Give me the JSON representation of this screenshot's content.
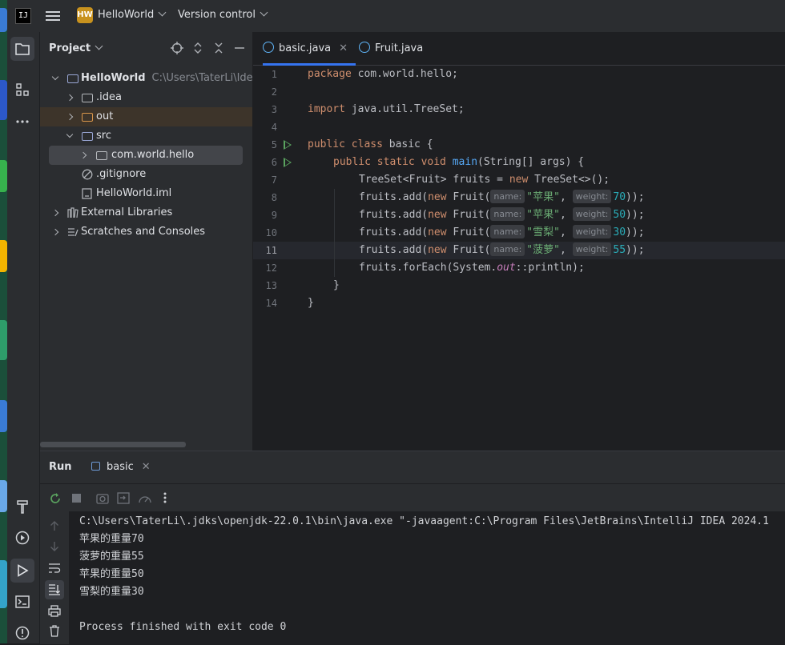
{
  "titlebar": {
    "logo": "IJ",
    "project_badge": "HW",
    "project_name": "HelloWorld",
    "vcs_label": "Version control",
    "menu_icon": "hamburger-icon"
  },
  "project_panel": {
    "title": "Project",
    "tree": [
      {
        "label": "HelloWorld",
        "path": "C:\\Users\\TaterLi\\IdeaPr",
        "expanded": true,
        "icon": "module-folder-icon"
      },
      {
        "label": ".idea",
        "icon": "folder-icon"
      },
      {
        "label": "out",
        "icon": "folder-icon"
      },
      {
        "label": "src",
        "expanded": true,
        "icon": "source-folder-icon"
      },
      {
        "label": "com.world.hello",
        "icon": "package-icon"
      },
      {
        "label": ".gitignore",
        "icon": "gitignore-icon"
      },
      {
        "label": "HelloWorld.iml",
        "icon": "file-icon"
      },
      {
        "label": "External Libraries",
        "icon": "library-icon"
      },
      {
        "label": "Scratches and Consoles",
        "icon": "scratches-icon"
      }
    ]
  },
  "editor": {
    "tabs": [
      {
        "label": "basic.java",
        "active": true
      },
      {
        "label": "Fruit.java",
        "active": false
      }
    ],
    "line_numbers": [
      "1",
      "2",
      "3",
      "4",
      "5",
      "6",
      "7",
      "8",
      "9",
      "10",
      "11",
      "12",
      "13",
      "14"
    ],
    "current_line": "11",
    "code": {
      "l1_kw": "package",
      "l1_rest": " com.world.hello;",
      "l3_kw": "import",
      "l3_rest": " java.util.TreeSet;",
      "l5_kw": "public class",
      "l5_rest": " basic {",
      "l6_kw": "public static void",
      "l6_fn": "main",
      "l6_rest": "(String[] args) {",
      "l7_a": "TreeSet<Fruit> fruits = ",
      "l7_kw": "new",
      "l7_b": " TreeSet<>();",
      "add_prefix": "fruits.add(",
      "new_kw": "new",
      "fruit_ctor": " Fruit(",
      "name_hint": "name:",
      "weight_hint": "weight:",
      "rows": [
        {
          "name": "\"苹果\"",
          "weight": "70"
        },
        {
          "name": "\"苹果\"",
          "weight": "50"
        },
        {
          "name": "\"雪梨\"",
          "weight": "30"
        },
        {
          "name": "\"菠萝\"",
          "weight": "55"
        }
      ],
      "comma": ", ",
      "close": "));",
      "l12_a": "fruits.forEach(System.",
      "l12_out": "out",
      "l12_b": "::println);",
      "l13": "}",
      "l14": "}"
    }
  },
  "run_panel": {
    "title": "Run",
    "tab_label": "basic",
    "console": [
      "C:\\Users\\TaterLi\\.jdks\\openjdk-22.0.1\\bin\\java.exe \"-javaagent:C:\\Program Files\\JetBrains\\IntelliJ IDEA 2024.1",
      "苹果的重量70",
      "菠萝的重量55",
      "苹果的重量50",
      "雪梨的重量30",
      "",
      "Process finished with exit code 0"
    ]
  },
  "colors": {
    "accent": "#3574f0",
    "keyword": "#cf8e6d",
    "function": "#56a8f5",
    "string": "#6aab73",
    "number": "#2aacb8",
    "run_green": "#5aa35f"
  }
}
